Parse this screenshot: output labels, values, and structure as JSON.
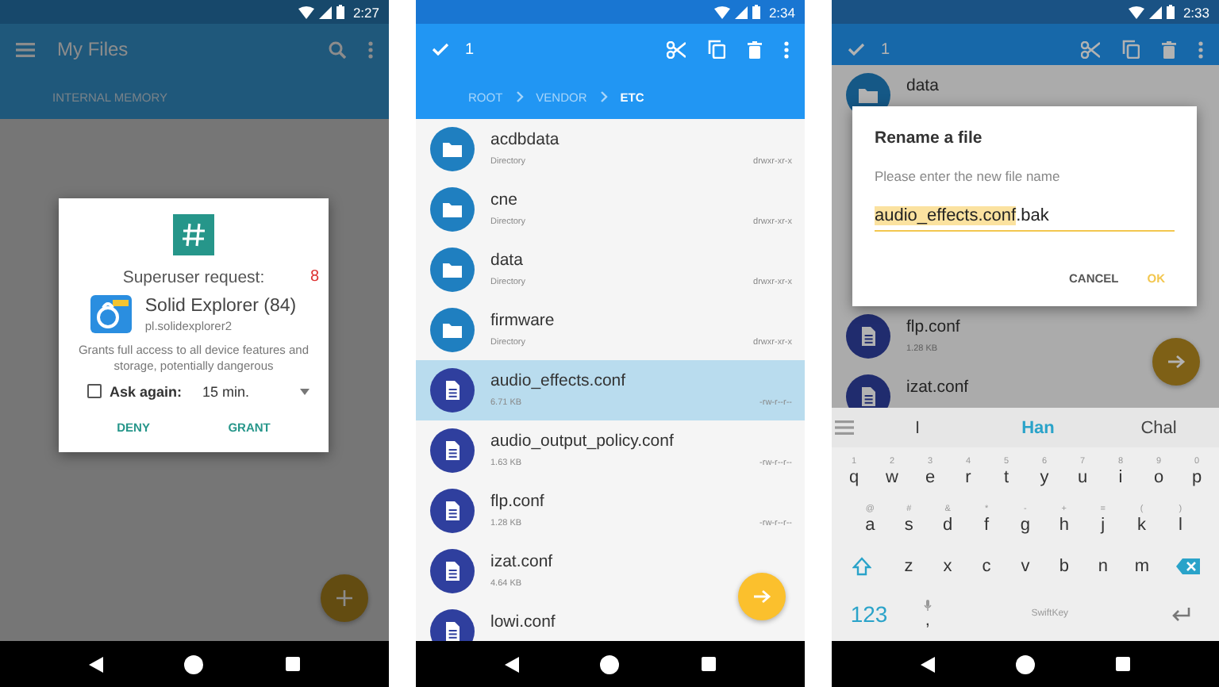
{
  "phones": [
    {
      "kind": "superuser",
      "time": "2:27",
      "toolbar": {
        "title": "My Files",
        "tab": "INTERNAL MEMORY"
      },
      "dialog": {
        "title": "Superuser request:",
        "countdown": "8",
        "app_name": "Solid Explorer (84)",
        "package": "pl.solidexplorer2",
        "description": "Grants full access to all device features and storage, potentially dangerous",
        "ask_again": {
          "label": "Ask again:",
          "checked": false
        },
        "duration": "15 min.",
        "buttons": [
          "DENY",
          "GRANT"
        ]
      }
    },
    {
      "kind": "browser",
      "time": "2:34",
      "selection_count": "1",
      "breadcrumb": [
        {
          "label": "ROOT",
          "selected": false
        },
        {
          "label": "VENDOR",
          "selected": false
        },
        {
          "label": "ETC",
          "selected": true
        }
      ],
      "files": [
        {
          "name": "acdbdata",
          "kind": "folder",
          "detail": "Directory",
          "permissions": "drwxr-xr-x",
          "selected": false
        },
        {
          "name": "cne",
          "kind": "folder",
          "detail": "Directory",
          "permissions": "drwxr-xr-x",
          "selected": false
        },
        {
          "name": "data",
          "kind": "folder",
          "detail": "Directory",
          "permissions": "drwxr-xr-x",
          "selected": false
        },
        {
          "name": "firmware",
          "kind": "folder",
          "detail": "Directory",
          "permissions": "drwxr-xr-x",
          "selected": false
        },
        {
          "name": "audio_effects.conf",
          "kind": "file",
          "detail": "6.71 KB",
          "permissions": "-rw-r--r--",
          "selected": true
        },
        {
          "name": "audio_output_policy.conf",
          "kind": "file",
          "detail": "1.63 KB",
          "permissions": "-rw-r--r--",
          "selected": false
        },
        {
          "name": "flp.conf",
          "kind": "file",
          "detail": "1.28 KB",
          "permissions": "-rw-r--r--",
          "selected": false
        },
        {
          "name": "izat.conf",
          "kind": "file",
          "detail": "4.64 KB",
          "selected": false
        },
        {
          "name": "lowi.conf",
          "kind": "file",
          "selected": false
        }
      ]
    },
    {
      "kind": "rename",
      "time": "2:33",
      "selection_count": "1",
      "files": [
        {
          "name": "data",
          "kind": "folder",
          "selected": false
        },
        {
          "name": "flp.conf",
          "kind": "file",
          "detail": "1.28 KB",
          "selected": false
        },
        {
          "name": "izat.conf",
          "kind": "file",
          "selected": false
        }
      ],
      "dialog": {
        "title": "Rename a file",
        "message": "Please enter the new file name",
        "selected_text": "audio_effects.conf",
        "rest_text": ".bak",
        "buttons": [
          "CANCEL",
          "OK"
        ]
      },
      "keyboard": {
        "suggestions": [
          {
            "label": "I",
            "selected": false
          },
          {
            "label": "Han",
            "selected": true
          },
          {
            "label": "Chal",
            "selected": false
          }
        ],
        "rows": [
          [
            {
              "key": "q",
              "hint": "1"
            },
            {
              "key": "w",
              "hint": "2"
            },
            {
              "key": "e",
              "hint": "3"
            },
            {
              "key": "r",
              "hint": "4"
            },
            {
              "key": "t",
              "hint": "5"
            },
            {
              "key": "y",
              "hint": "6"
            },
            {
              "key": "u",
              "hint": "7"
            },
            {
              "key": "i",
              "hint": "8"
            },
            {
              "key": "o",
              "hint": "9"
            },
            {
              "key": "p",
              "hint": "0"
            }
          ],
          [
            {
              "key": "a",
              "hint": "@"
            },
            {
              "key": "s",
              "hint": "#"
            },
            {
              "key": "d",
              "hint": "&"
            },
            {
              "key": "f",
              "hint": "*"
            },
            {
              "key": "g",
              "hint": "-"
            },
            {
              "key": "h",
              "hint": "+"
            },
            {
              "key": "j",
              "hint": "="
            },
            {
              "key": "k",
              "hint": "("
            },
            {
              "key": "l",
              "hint": ")"
            }
          ],
          [
            {
              "key": "z"
            },
            {
              "key": "x"
            },
            {
              "key": "c"
            },
            {
              "key": "v"
            },
            {
              "key": "b"
            },
            {
              "key": "n"
            },
            {
              "key": "m"
            }
          ]
        ],
        "mode_key": "123",
        "comma_key": ",",
        "space_label": "SwiftKey"
      }
    }
  ]
}
